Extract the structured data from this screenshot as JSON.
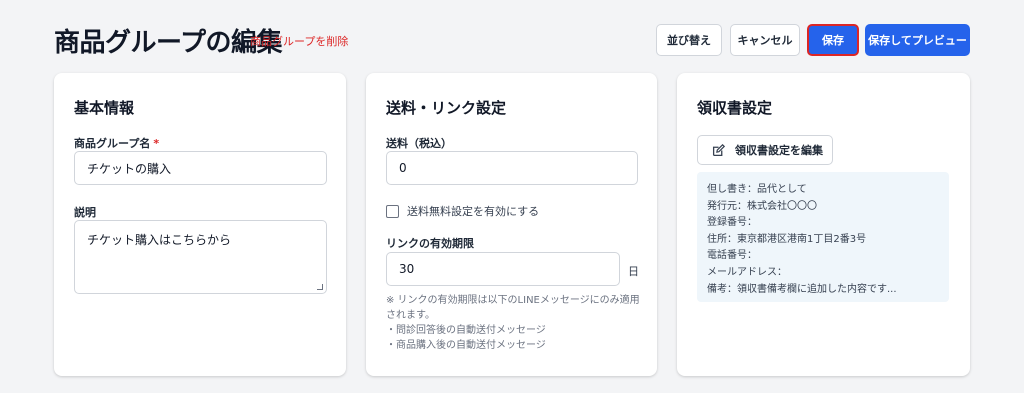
{
  "header": {
    "title": "商品グループの編集",
    "delete_link": "商品グループを削除",
    "sort_button": "並び替え",
    "cancel_button": "キャンセル",
    "save_button": "保存",
    "save_preview_button": "保存してプレビュー"
  },
  "basic_info": {
    "title": "基本情報",
    "name_label": "商品グループ名",
    "required_mark": "*",
    "name_value": "チケットの購入",
    "description_label": "説明",
    "description_value": "チケット購入はこちらから"
  },
  "shipping": {
    "title": "送料・リンク設定",
    "fee_label": "送料（税込）",
    "fee_value": "0",
    "free_shipping_checkbox": "送料無料設定を有効にする",
    "free_shipping_checked": false,
    "link_expiry_label": "リンクの有効期限",
    "link_expiry_value": "30",
    "link_expiry_unit": "日",
    "note_lines": [
      "※ リンクの有効期限は以下のLINEメッセージにのみ適用",
      "されます。",
      "・問診回答後の自動送付メッセージ",
      "・商品購入後の自動送付メッセージ"
    ]
  },
  "receipt": {
    "title": "領収書設定",
    "edit_button": "領収書設定を編集",
    "lines": [
      "但し書き：品代として",
      "発行元：株式会社〇〇〇",
      "登録番号：",
      "住所：東京都港区港南1丁目2番3号",
      "電話番号：",
      "メールアドレス：",
      "備考：領収書備考欄に追加した内容です..."
    ]
  },
  "colors": {
    "primary": "#2563eb",
    "danger": "#dc2626",
    "background": "#f3f4f6",
    "receipt_box": "#eff6fb"
  }
}
